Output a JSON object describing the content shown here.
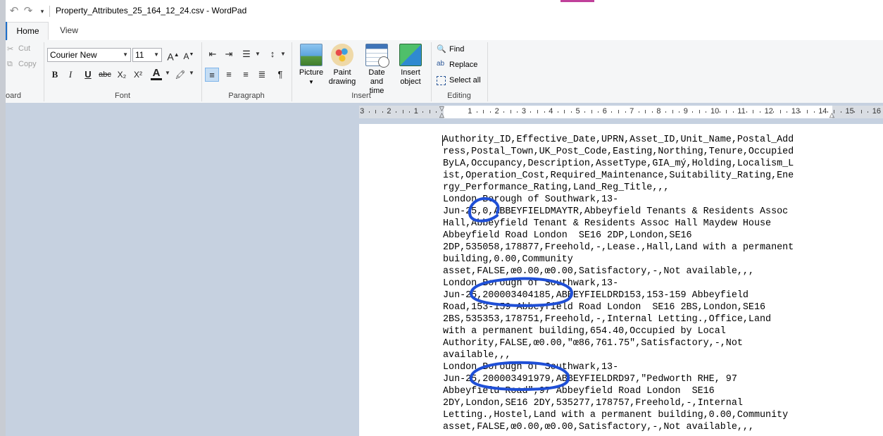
{
  "window": {
    "title": "Property_Attributes_25_164_12_24.csv - WordPad",
    "quick_access": {
      "undo_icon": "undo-icon",
      "redo_icon": "redo-icon",
      "customize_icon": "chevron-down-icon"
    }
  },
  "tabs": [
    {
      "label": "Home",
      "active": true
    },
    {
      "label": "View",
      "active": false
    }
  ],
  "ribbon": {
    "clipboard": {
      "cut": "Cut",
      "copy": "Copy",
      "group_label": "oard"
    },
    "font": {
      "family": "Courier New",
      "size": "11",
      "group_label": "Font",
      "buttons": [
        "B",
        "I",
        "U",
        "abc",
        "X₂",
        "X²",
        "A",
        "🖍"
      ]
    },
    "paragraph": {
      "group_label": "Paragraph"
    },
    "insert": {
      "group_label": "Insert",
      "picture": "Picture",
      "paint_line1": "Paint",
      "paint_line2": "drawing",
      "date_line1": "Date and",
      "date_line2": "time",
      "object_line1": "Insert",
      "object_line2": "object"
    },
    "editing": {
      "group_label": "Editing",
      "find": "Find",
      "replace": "Replace",
      "select_all": "Select all"
    }
  },
  "ruler": {
    "labels": [
      "3",
      "2",
      "1",
      "1",
      "2",
      "3",
      "4",
      "5",
      "6",
      "7",
      "8",
      "9",
      "10",
      "11",
      "12",
      "13",
      "14",
      "15",
      "16"
    ]
  },
  "document": {
    "lines": [
      "Authority_ID,Effective_Date,UPRN,Asset_ID,Unit_Name,Postal_Add",
      "ress,Postal_Town,UK_Post_Code,Easting,Northing,Tenure,Occupied",
      "ByLA,Occupancy,Description,AssetType,GIA_mý,Holding,Localism_L",
      "ist,Operation_Cost,Required_Maintenance,Suitability_Rating,Ene",
      "rgy_Performance_Rating,Land_Reg_Title,,,",
      "London Borough of Southwark,13-",
      "Jun-25,0,ABBEYFIELDMAYTR,Abbeyfield Tenants & Residents Assoc",
      "Hall,Abbeyfield Tenant & Residents Assoc Hall Maydew House",
      "Abbeyfield Road London  SE16 2DP,London,SE16",
      "2DP,535058,178877,Freehold,-,Lease.,Hall,Land with a permanent",
      "building,0.00,Community",
      "asset,FALSE,œ0.00,œ0.00,Satisfactory,-,Not available,,,",
      "London Borough of Southwark,13-",
      "Jun-25,200003404185,ABBEYFIELDRD153,153-159 Abbeyfield",
      "Road,153-159 Abbeyfield Road London  SE16 2BS,London,SE16",
      "2BS,535353,178751,Freehold,-,Internal Letting.,Office,Land",
      "with a permanent building,654.40,Occupied by Local",
      "Authority,FALSE,œ0.00,\"œ86,761.75\",Satisfactory,-,Not",
      "available,,,",
      "London Borough of Southwark,13-",
      "Jun-25,200003491979,ABBEYFIELDRD97,\"Pedworth RHE, 97",
      "Abbeyfield Road\",97 Abbeyfield Road London  SE16",
      "2DY,London,SE16 2DY,535277,178757,Freehold,-,Internal",
      "Letting.,Hostel,Land with a permanent building,0.00,Community",
      "asset,FALSE,œ0.00,œ0.00,Satisfactory,-,Not available,,,"
    ]
  },
  "annotations": {
    "color": "#1f4fd6",
    "circled_values": [
      "0",
      "200003404185",
      "200003491979"
    ]
  },
  "colors": {
    "workspace": "#c6d1e0",
    "ribbon": "#f5f6f7",
    "home_accent": "#1e6fc9"
  }
}
